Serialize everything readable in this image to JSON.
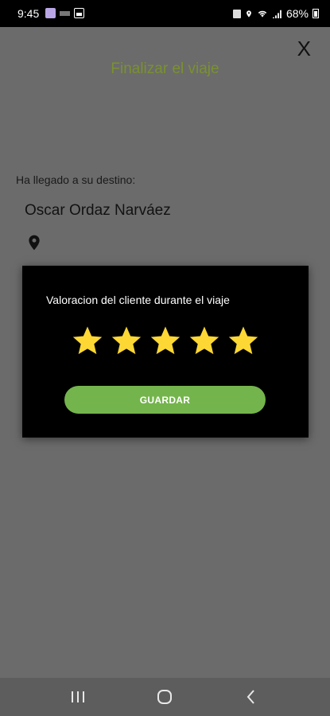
{
  "status_bar": {
    "time": "9:45",
    "battery": "68%",
    "left_icons": [
      "app-icon",
      "notification-icon",
      "image-icon"
    ],
    "right_icons": [
      "mute-icon",
      "location-icon",
      "wifi-icon",
      "signal-icon",
      "battery-icon"
    ]
  },
  "header": {
    "title": "Finalizar el viaje",
    "close_label": "X"
  },
  "trip": {
    "arrived_text": "Ha llegado a su destino:",
    "client_name": "Oscar Ordaz Narváez",
    "location_icon": "location-pin-icon"
  },
  "rating_dialog": {
    "prompt": "Valoracion del cliente durante el viaje",
    "rating": 5,
    "max_rating": 5,
    "save_label": "GUARDAR",
    "star_color": "#fdd835",
    "button_color": "#74b44c"
  },
  "nav_bar": {
    "buttons": [
      "recent-apps-icon",
      "home-icon",
      "back-icon"
    ]
  },
  "colors": {
    "overlay": "#6b6b6b",
    "title": "#7a9130"
  }
}
